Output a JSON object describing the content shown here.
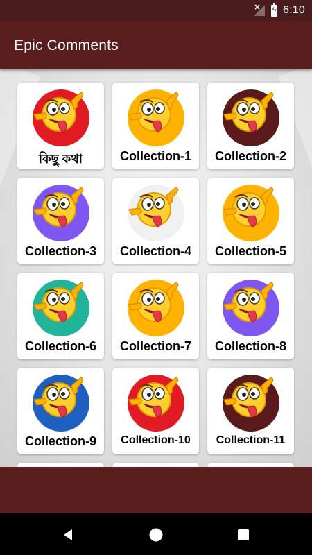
{
  "status_bar": {
    "time": "6:10",
    "icons": [
      "no-signal-icon",
      "battery-charging-icon"
    ]
  },
  "app_bar": {
    "title": "Epic Comments"
  },
  "grid": {
    "items": [
      {
        "label": "কিছু কথা",
        "color": "#e01b24"
      },
      {
        "label": "Collection-1",
        "color": "#ffb300"
      },
      {
        "label": "Collection-2",
        "color": "#5a1a1c"
      },
      {
        "label": "Collection-3",
        "color": "#7e57f3"
      },
      {
        "label": "Collection-4",
        "color": "#f0f0f0"
      },
      {
        "label": "Collection-5",
        "color": "#ffb300"
      },
      {
        "label": "Collection-6",
        "color": "#20b59a"
      },
      {
        "label": "Collection-7",
        "color": "#ffb300"
      },
      {
        "label": "Collection-8",
        "color": "#7e57f3"
      },
      {
        "label": "Collection-9",
        "color": "#1f5fbf"
      },
      {
        "label": "Collection-10",
        "color": "#e01b24"
      },
      {
        "label": "Collection-11",
        "color": "#5a1a1c"
      }
    ]
  },
  "navigation": {
    "back": "back-icon",
    "home": "home-icon",
    "recents": "recents-icon"
  },
  "colors": {
    "primary": "#5b1e1f",
    "status_bar": "#4a1c1d"
  }
}
